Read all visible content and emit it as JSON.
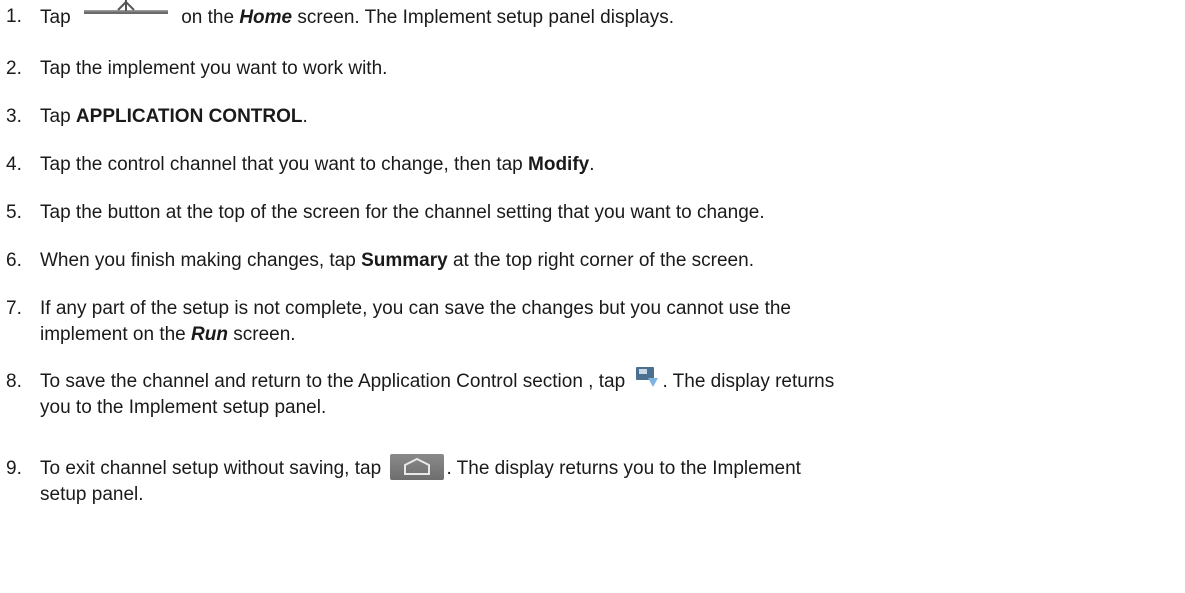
{
  "steps": [
    {
      "number": "1.",
      "before": "Tap",
      "icon": "implement-boom-icon",
      "between": "on the",
      "screen_name": "Home",
      "after": "screen. The Implement setup panel displays."
    },
    {
      "number": "2.",
      "text": "Tap the implement you want to work with."
    },
    {
      "number": "3.",
      "before": "Tap",
      "bold": "APPLICATION CONTROL",
      "after": "."
    },
    {
      "number": "4.",
      "before": "Tap the control channel that you want to change, then tap",
      "bold": "Modify",
      "after": "."
    },
    {
      "number": "5.",
      "text": "Tap the button at the top of the screen for the channel setting that you want to change."
    },
    {
      "number": "6.",
      "before": "When you finish making changes, tap",
      "bold": "Summary",
      "after": "at the top right corner of the screen."
    },
    {
      "number": "7.",
      "line1": "If any part of the setup is not complete, you can save the changes but you cannot use the",
      "before": "implement on the",
      "screen_name": "Run",
      "after": "screen."
    },
    {
      "number": "8.",
      "before": "To save the channel and return to the Application Control section , tap",
      "icon": "save-return-icon",
      "after": ". The display returns",
      "line2": "you to the Implement setup panel."
    },
    {
      "number": "9.",
      "before": "To exit channel setup without saving, tap",
      "icon": "home-button-icon",
      "after": ". The display returns you to the Implement",
      "line2": "setup panel."
    }
  ]
}
